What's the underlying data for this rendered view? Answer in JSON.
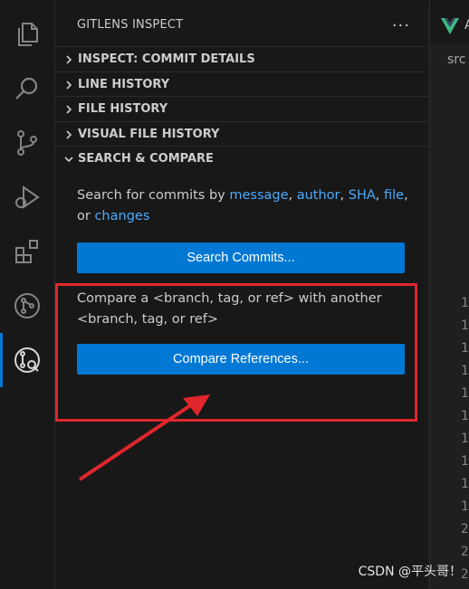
{
  "sidebar": {
    "title": "GITLENS INSPECT",
    "more": "···",
    "sections": [
      {
        "label": "INSPECT: COMMIT DETAILS",
        "expanded": false
      },
      {
        "label": "LINE HISTORY",
        "expanded": false
      },
      {
        "label": "FILE HISTORY",
        "expanded": false
      },
      {
        "label": "VISUAL FILE HISTORY",
        "expanded": false
      },
      {
        "label": "SEARCH & COMPARE",
        "expanded": true
      }
    ]
  },
  "search": {
    "prefix": "Search for commits by ",
    "links": [
      "message",
      "author",
      "SHA",
      "file",
      "changes"
    ],
    "sep1": ", ",
    "sep_or": ", or ",
    "button": "Search Commits..."
  },
  "compare": {
    "text": "Compare a <branch, tag, or ref> with another <branch, tag, or ref>",
    "button": "Compare References..."
  },
  "editor": {
    "tab_letter": "A",
    "breadcrumb": "src",
    "line_numbers": [
      "1",
      "1",
      "1",
      "1",
      "1",
      "1",
      "1",
      "1",
      "1",
      "1",
      "2",
      "2",
      "2"
    ]
  },
  "watermark": "CSDN @平头哥！",
  "colors": {
    "accent": "#0078d4",
    "link": "#4daafc",
    "highlight": "#e0262c"
  }
}
